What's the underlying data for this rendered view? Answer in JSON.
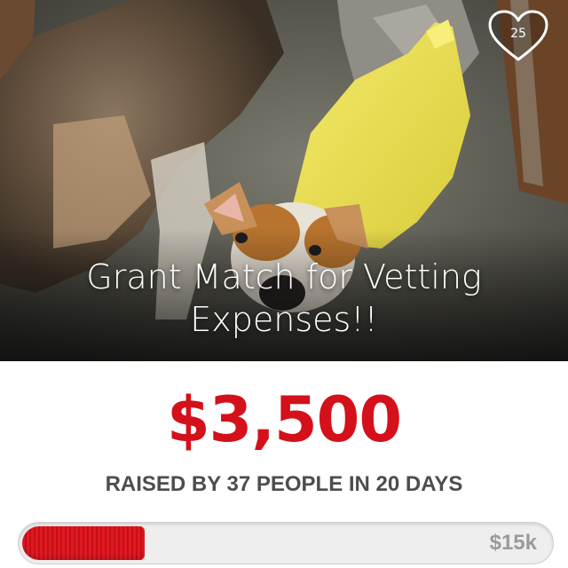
{
  "campaign": {
    "title": "Grant Match for Vetting Expenses!!",
    "amount_raised": "$3,500",
    "raised_line": "RAISED BY 37 PEOPLE IN 20 DAYS",
    "likes": "25",
    "goal_label": "$15k",
    "progress_fraction": 0.233
  },
  "icons": {
    "like": "heart-icon"
  },
  "colors": {
    "accent": "#d4101a",
    "progress_fill": "#e01a22",
    "muted_text": "#4d4d4d",
    "goal_text": "#9a9a9a"
  }
}
